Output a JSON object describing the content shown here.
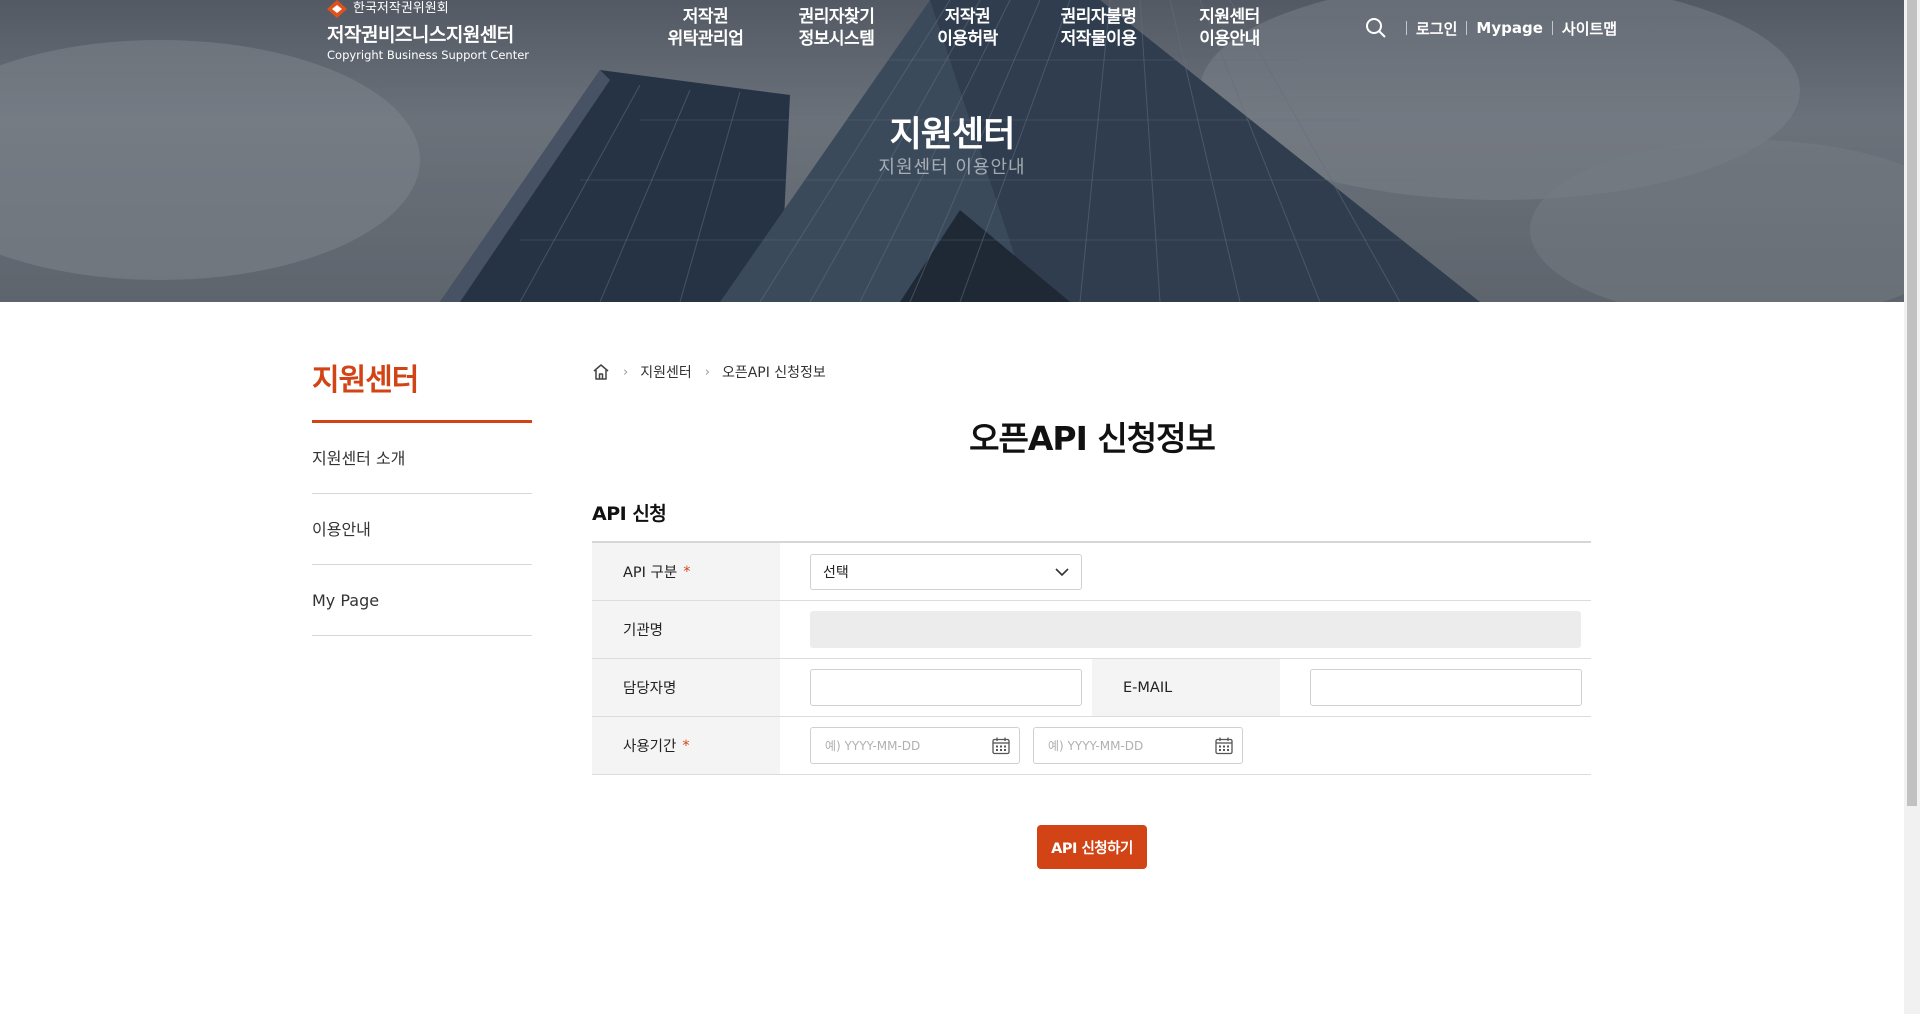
{
  "header": {
    "org_name": "한국저작권위원회",
    "site_name": "저작권비즈니스지원센터",
    "site_name_en": "Copyright Business Support Center",
    "gnb": [
      {
        "line1": "저작권",
        "line2": "위탁관리업"
      },
      {
        "line1": "권리자찾기",
        "line2": "정보시스템"
      },
      {
        "line1": "저작권",
        "line2": "이용허락"
      },
      {
        "line1": "권리자불명",
        "line2": "저작물이용"
      },
      {
        "line1": "지원센터",
        "line2": "이용안내"
      }
    ],
    "util": {
      "search_icon": "search-icon",
      "login": "로그인",
      "mypage": "Mypage",
      "sitemap": "사이트맵"
    }
  },
  "hero": {
    "title": "지원센터",
    "subtitle": "지원센터 이용안내"
  },
  "sidebar": {
    "title": "지원센터",
    "items": [
      {
        "label": "지원센터 소개"
      },
      {
        "label": "이용안내"
      },
      {
        "label": "My Page"
      }
    ]
  },
  "breadcrumb": {
    "home_icon": "home-icon",
    "items": [
      "지원센터",
      "오픈API 신청정보"
    ]
  },
  "page_title": "오픈API 신청정보",
  "section_title": "API 신청",
  "form": {
    "api_type": {
      "label": "API 구분",
      "required_mark": "*",
      "selected": "선택"
    },
    "org_name": {
      "label": "기관명",
      "value": ""
    },
    "manager": {
      "label": "담당자명",
      "value": ""
    },
    "email": {
      "label": "E-MAIL",
      "value": ""
    },
    "period": {
      "label": "사용기간",
      "required_mark": "*",
      "start_placeholder": "예) YYYY-MM-DD",
      "end_placeholder": "예) YYYY-MM-DD"
    }
  },
  "submit_label": "API 신청하기",
  "colors": {
    "accent": "#d24416",
    "table_header_bg": "#f4f4f4"
  }
}
